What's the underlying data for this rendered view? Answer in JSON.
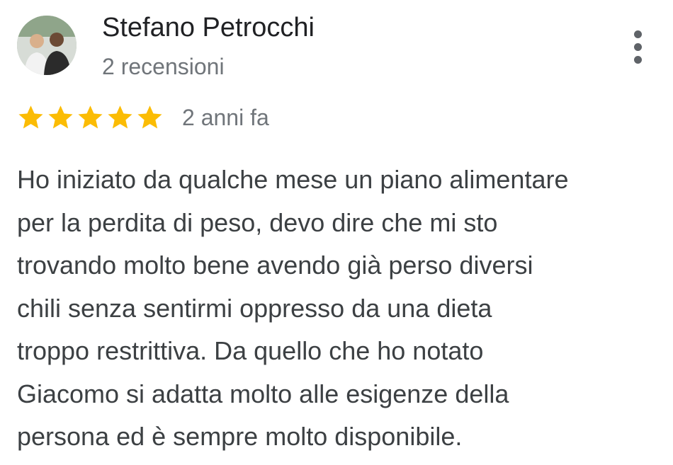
{
  "review": {
    "author": {
      "name": "Stefano Petrocchi",
      "review_count": "2 recensioni",
      "avatar_icon": "profile-photo-icon"
    },
    "menu_icon": "more-vert-icon",
    "rating": {
      "value": 5,
      "max": 5,
      "star_color": "#fbbc04"
    },
    "date": "2 anni fa",
    "text_lines": [
      "Ho iniziato da qualche mese un piano alimentare",
      "per la perdita di peso, devo dire che mi sto",
      "trovando molto bene avendo già perso diversi",
      "chili senza sentirmi oppresso da una dieta",
      "troppo restrittiva. Da quello che ho notato",
      "Giacomo si adatta molto alle esigenze della",
      "persona ed è sempre molto disponibile."
    ]
  }
}
